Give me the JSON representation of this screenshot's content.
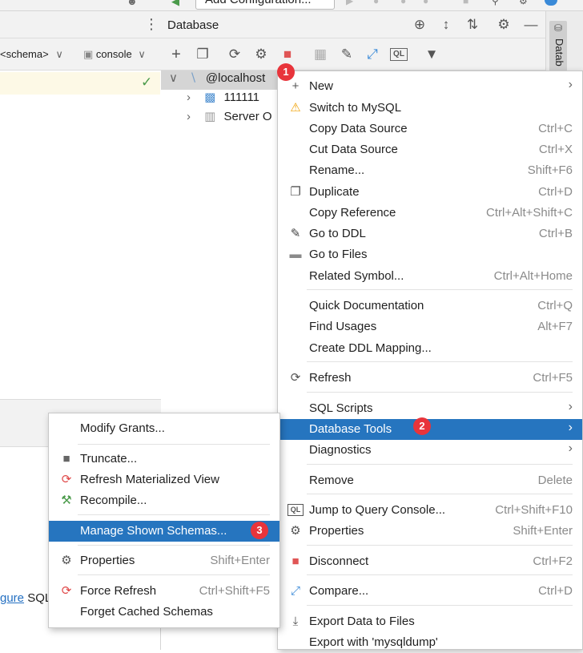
{
  "top": {
    "add_configuration_label": "Add Configuration..."
  },
  "left": {
    "schema_label": "<schema>",
    "console_label": "console",
    "link_text": "gure",
    "after_link_text": "SQL"
  },
  "db_panel": {
    "title": "Database",
    "side_tab_label": "Datab",
    "tree": [
      {
        "label": "@localhost",
        "icon": "mysql-datasource-icon"
      },
      {
        "label": "111111",
        "icon": "schema-icon"
      },
      {
        "label": "Server O",
        "icon": "server-objects-icon"
      }
    ]
  },
  "context_menu": {
    "items": [
      {
        "label": "New",
        "shortcut": "",
        "icon": "plus-icon",
        "submenu": true
      },
      {
        "label": "Switch to MySQL",
        "shortcut": "",
        "icon": "warning-icon"
      },
      {
        "label": "Copy Data Source",
        "shortcut": "Ctrl+C"
      },
      {
        "label": "Cut Data Source",
        "shortcut": "Ctrl+X"
      },
      {
        "label": "Rename...",
        "shortcut": "Shift+F6"
      },
      {
        "label": "Duplicate",
        "shortcut": "Ctrl+D",
        "icon": "duplicate-icon"
      },
      {
        "label": "Copy Reference",
        "shortcut": "Ctrl+Alt+Shift+C"
      },
      {
        "label": "Go to DDL",
        "shortcut": "Ctrl+B",
        "icon": "pencil-icon"
      },
      {
        "label": "Go to Files",
        "shortcut": "",
        "icon": "folder-icon"
      },
      {
        "label": "Related Symbol...",
        "shortcut": "Ctrl+Alt+Home"
      },
      {
        "label": "Quick Documentation",
        "shortcut": "Ctrl+Q"
      },
      {
        "label": "Find Usages",
        "shortcut": "Alt+F7"
      },
      {
        "label": "Create DDL Mapping...",
        "shortcut": ""
      },
      {
        "label": "Refresh",
        "shortcut": "Ctrl+F5",
        "icon": "refresh-icon"
      },
      {
        "label": "SQL Scripts",
        "shortcut": "",
        "submenu": true
      },
      {
        "label": "Database Tools",
        "shortcut": "",
        "submenu": true,
        "selected": true
      },
      {
        "label": "Diagnostics",
        "shortcut": "",
        "submenu": true
      },
      {
        "label": "Remove",
        "shortcut": "Delete"
      },
      {
        "label": "Jump to Query Console...",
        "shortcut": "Ctrl+Shift+F10",
        "icon": "query-console-icon"
      },
      {
        "label": "Properties",
        "shortcut": "Shift+Enter",
        "icon": "properties-icon"
      },
      {
        "label": "Disconnect",
        "shortcut": "Ctrl+F2",
        "icon": "stop-icon"
      },
      {
        "label": "Compare...",
        "shortcut": "Ctrl+D",
        "icon": "compare-icon"
      },
      {
        "label": "Export Data to Files",
        "shortcut": "",
        "icon": "export-icon"
      },
      {
        "label": "Export with 'mysqldump'",
        "shortcut": ""
      }
    ]
  },
  "submenu": {
    "items": [
      {
        "label": "Modify Grants...",
        "shortcut": ""
      },
      {
        "label": "Truncate...",
        "shortcut": "",
        "icon": "trash-icon"
      },
      {
        "label": "Refresh Materialized View",
        "shortcut": "",
        "icon": "refresh-red-icon"
      },
      {
        "label": "Recompile...",
        "shortcut": "",
        "icon": "hammer-icon"
      },
      {
        "label": "Manage Shown Schemas...",
        "shortcut": "",
        "selected": true
      },
      {
        "label": "Properties",
        "shortcut": "Shift+Enter",
        "icon": "properties-icon"
      },
      {
        "label": "Force Refresh",
        "shortcut": "Ctrl+Shift+F5",
        "icon": "refresh-red-icon"
      },
      {
        "label": "Forget Cached Schemas",
        "shortcut": ""
      }
    ]
  },
  "badges": [
    "1",
    "2",
    "3"
  ],
  "colors": {
    "selection": "#2675bf",
    "badge": "#e8343b",
    "warning": "#f0a30a",
    "stop": "#e05555",
    "link": "#2470c2"
  }
}
